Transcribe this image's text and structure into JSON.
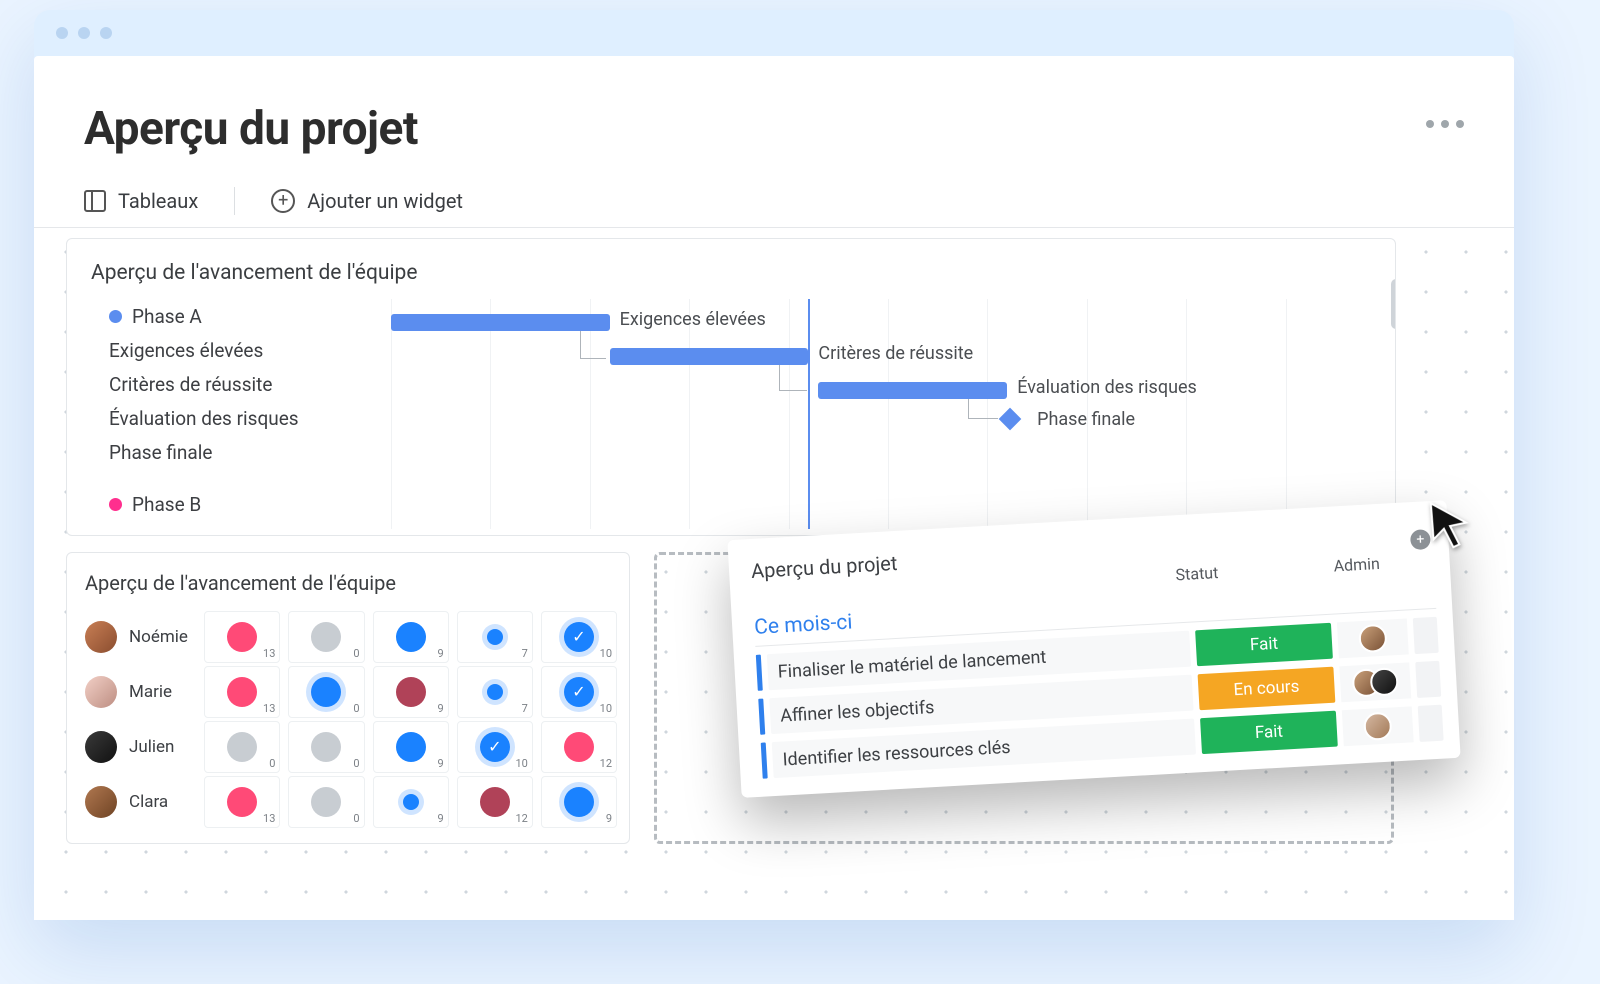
{
  "header": {
    "title": "Aperçu du projet"
  },
  "toolbar": {
    "tableaux_label": "Tableaux",
    "add_widget_label": "Ajouter un widget"
  },
  "gantt": {
    "title": "Aperçu de l'avancement de l'équipe",
    "phase_a_label": "Phase A",
    "phase_b_label": "Phase B",
    "rows": {
      "r1": "Exigences élevées",
      "r2": "Critères de réussite",
      "r3": "Évaluation des risques",
      "r4": "Phase finale"
    },
    "bar_labels": {
      "b1": "Exigences élevées",
      "b2": "Critères de réussite",
      "b3": "Évaluation des risques",
      "b4": "Phase finale"
    }
  },
  "matrix": {
    "title": "Aperçu de l'avancement de l'équipe",
    "people": {
      "p1": "Noémie",
      "p2": "Marie",
      "p3": "Julien",
      "p4": "Clara"
    },
    "counts": {
      "r1": {
        "c1": "13",
        "c2": "0",
        "c3": "9",
        "c4": "7",
        "c5": "10"
      },
      "r2": {
        "c1": "13",
        "c2": "0",
        "c3": "9",
        "c4": "7",
        "c5": "10"
      },
      "r3": {
        "c1": "0",
        "c2": "0",
        "c3": "9",
        "c4": "10",
        "c5": "12"
      },
      "r4": {
        "c1": "13",
        "c2": "0",
        "c3": "9",
        "c4": "12",
        "c5": "9"
      }
    }
  },
  "tasks": {
    "title": "Aperçu du projet",
    "col_status": "Statut",
    "col_admin": "Admin",
    "group_label": "Ce mois-ci",
    "items": {
      "t1": {
        "name": "Finaliser le matériel de lancement",
        "status": "Fait"
      },
      "t2": {
        "name": "Affiner les objectifs",
        "status": "En cours"
      },
      "t3": {
        "name": "Identifier les ressources clés",
        "status": "Fait"
      }
    }
  },
  "chart_data": {
    "type": "gantt",
    "title": "Aperçu de l'avancement de l'équipe",
    "groups": [
      {
        "name": "Phase A",
        "color": "#5b8def",
        "tasks": [
          {
            "name": "Exigences élevées",
            "start": 0,
            "end": 22,
            "label": "Exigences élevées"
          },
          {
            "name": "Critères de réussite",
            "start": 22,
            "end": 42,
            "label": "Critères de réussite"
          },
          {
            "name": "Évaluation des risques",
            "start": 42,
            "end": 62,
            "label": "Évaluation des risques"
          },
          {
            "name": "Phase finale",
            "start": 62,
            "end": 62,
            "milestone": true,
            "label": "Phase finale"
          }
        ]
      },
      {
        "name": "Phase B",
        "color": "#ff2f8e",
        "tasks": []
      }
    ],
    "today_marker": 42,
    "x_range": [
      0,
      100
    ]
  }
}
